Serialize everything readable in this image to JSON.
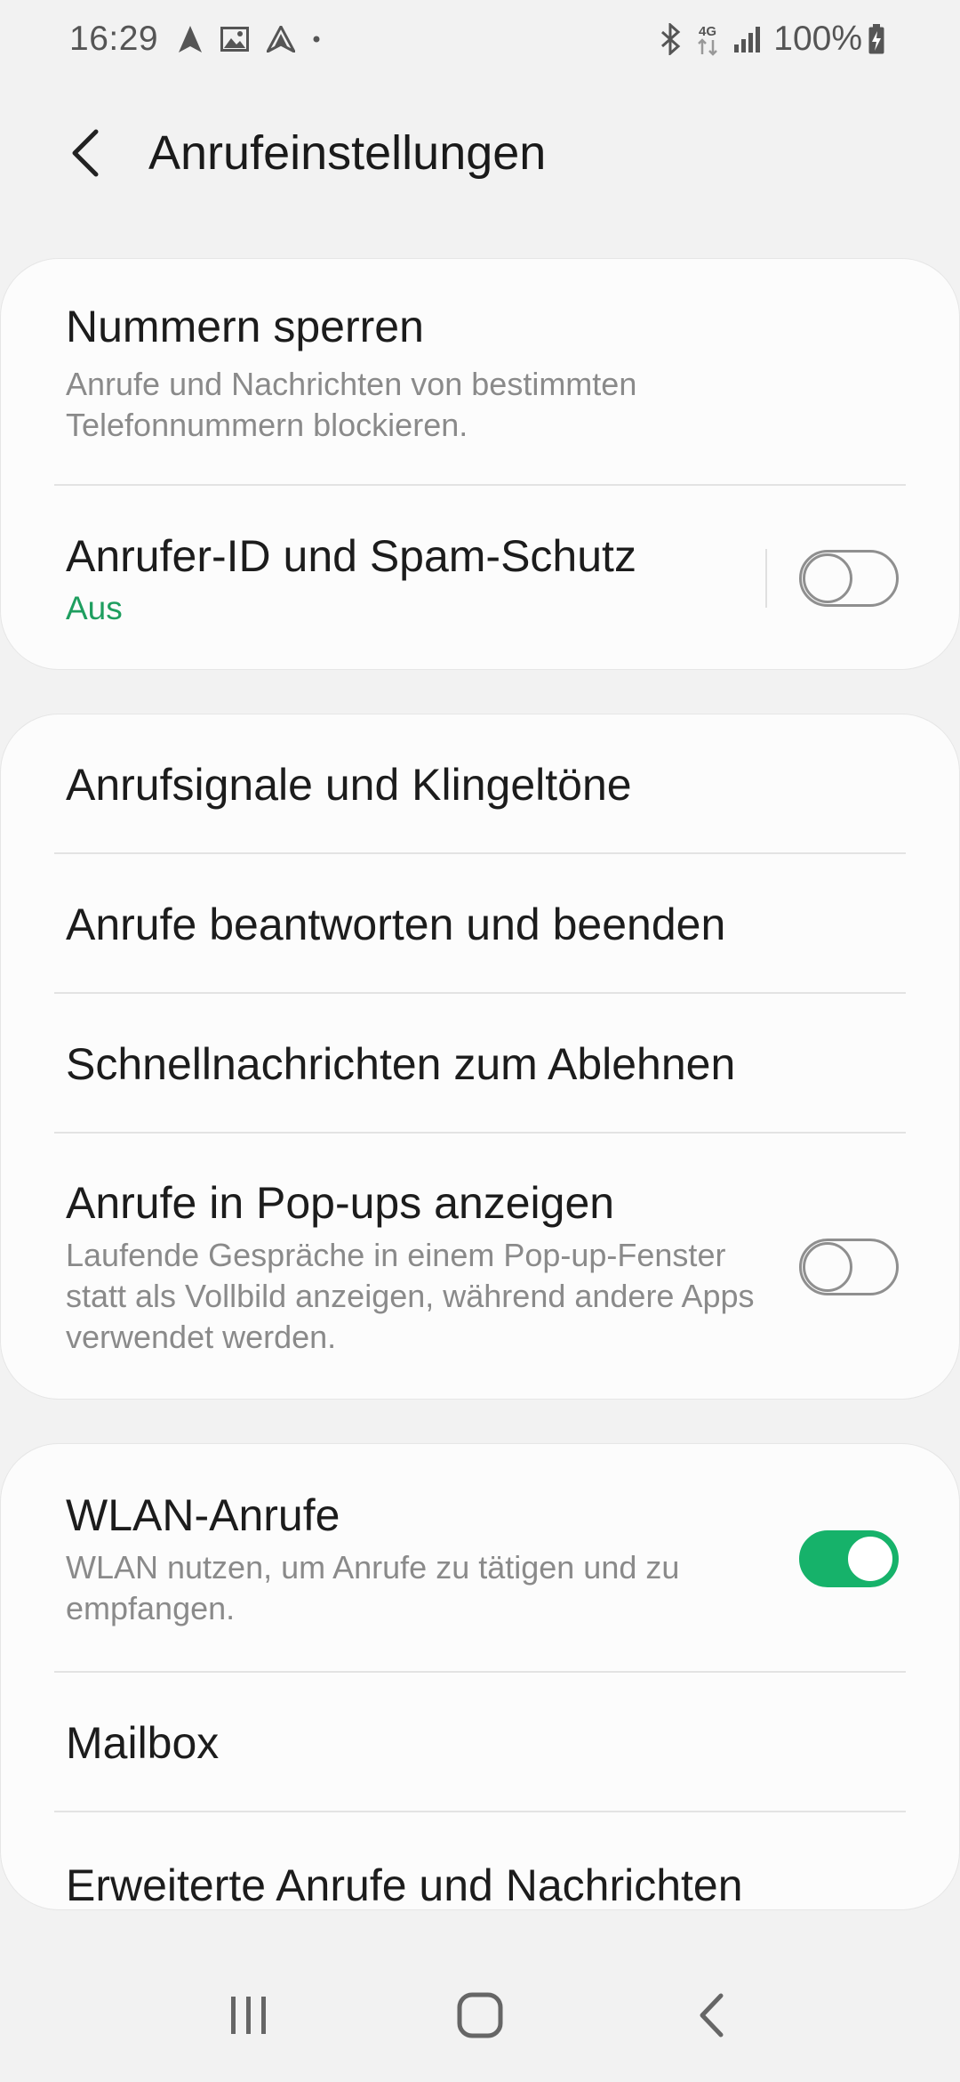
{
  "status_bar": {
    "time": "16:29",
    "left_icons": [
      "navigation-icon",
      "image-icon",
      "arrow-up-icon",
      "dot-icon"
    ],
    "right_icons": [
      "bluetooth-icon",
      "4g-icon",
      "signal-icon"
    ],
    "network_label": "4G",
    "battery_percent": "100%"
  },
  "app_bar": {
    "title": "Anrufeinstellungen"
  },
  "cards": [
    {
      "rows": [
        {
          "title": "Nummern sperren",
          "subtitle": "Anrufe und Nachrichten von bestimmten Telefonnummern blockieren."
        },
        {
          "title": "Anrufer-ID und Spam-Schutz",
          "status": "Aus",
          "toggle": false
        }
      ]
    },
    {
      "rows": [
        {
          "title": "Anrufsignale und Klingeltöne"
        },
        {
          "title": "Anrufe beantworten und beenden"
        },
        {
          "title": "Schnellnachrichten zum Ablehnen"
        },
        {
          "title": "Anrufe in Pop-ups anzeigen",
          "subtitle": "Laufende Gespräche in einem Pop-up-Fenster statt als Vollbild anzeigen, während andere Apps verwendet werden.",
          "toggle": false
        }
      ]
    },
    {
      "rows": [
        {
          "title": "WLAN-Anrufe",
          "subtitle": "WLAN nutzen, um Anrufe zu tätigen und zu empfangen.",
          "toggle": true
        },
        {
          "title": "Mailbox"
        },
        {
          "title": "Erweiterte Anrufe und Nachrichten"
        }
      ]
    }
  ],
  "colors": {
    "accent": "#16b26a",
    "status_text": "#1e9e5f",
    "background": "#f2f2f2",
    "card": "#fcfcfc"
  },
  "nav_bar": {
    "buttons": [
      "recent-apps-icon",
      "home-icon",
      "back-icon"
    ]
  }
}
